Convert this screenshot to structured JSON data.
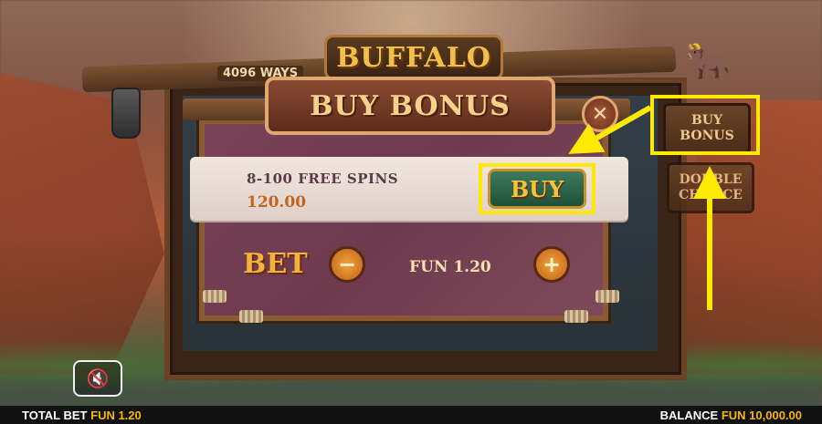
{
  "game": {
    "logo": "BUFFALO",
    "ways": "4096 WAYS"
  },
  "side_buttons": {
    "buy_bonus": [
      "BUY",
      "BONUS"
    ],
    "double_chance": [
      "DOUBLE",
      "CHANCE"
    ]
  },
  "dialog": {
    "title": "BUY BONUS",
    "close_icon": "close-icon",
    "offer": {
      "title": "8-100 FREE SPINS",
      "price": "120.00",
      "buy_label": "BUY"
    },
    "bet": {
      "label": "BET",
      "decrease_symbol": "−",
      "increase_symbol": "+",
      "value": "FUN 1.20"
    }
  },
  "mute_icon": "speaker-muted-icon",
  "status": {
    "total_bet_label": "TOTAL BET",
    "total_bet_value": "FUN 1.20",
    "balance_label": "BALANCE",
    "balance_value": "FUN 10,000.00"
  },
  "colors": {
    "highlight": "#ffe900",
    "accent": "#f5b800"
  }
}
